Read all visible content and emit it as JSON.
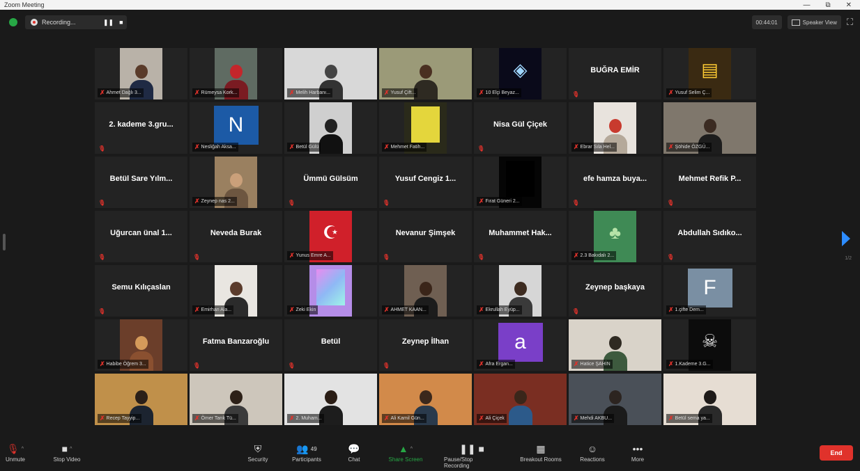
{
  "window": {
    "title": "Zoom Meeting",
    "controls": [
      "—",
      "⧉",
      "✕"
    ]
  },
  "topbar": {
    "recording_label": "Recording...",
    "pause_glyph": "❚❚",
    "stop_glyph": "■",
    "recording_timer": "00:44:01",
    "view_label": "Speaker View",
    "fullscreen_glyph": "⛶"
  },
  "gallery": {
    "page_indicator": "1/2",
    "tiles": [
      {
        "kind": "video",
        "label": "Ahmet Dağlı 3...",
        "bg": "#b9b2a8",
        "head": "#5a3b2a",
        "body": "#1f2a44"
      },
      {
        "kind": "video",
        "label": "Rümeysa Kork...",
        "bg": "#5f6b62",
        "head": "#c4262b",
        "body": "#7a1b22"
      },
      {
        "kind": "video",
        "label": "Melih Harbanı...",
        "bg": "#d8d8d8",
        "head": "#444",
        "body": "#333",
        "wide": true
      },
      {
        "kind": "video",
        "label": "Yusuf Çift...",
        "bg": "#9b9a78",
        "head": "#4a3021",
        "body": "#2e2a22",
        "wide": true,
        "active": true
      },
      {
        "kind": "image",
        "label": "10 Elçi Beyaz...",
        "bg": "#0a0a1a",
        "glyph": "◈",
        "color": "#9fd6ff"
      },
      {
        "kind": "name",
        "name": "BUĞRA EMİR"
      },
      {
        "kind": "image",
        "label": "Yusuf Selim Ç...",
        "bg": "#3a2a12",
        "glyph": "▤",
        "color": "#ffcc33"
      },
      {
        "kind": "name",
        "name": "2. kademe 3.gru..."
      },
      {
        "kind": "avatar",
        "label": "Nesliğah Aksa...",
        "bg": "#1c5aa6",
        "letter": "N"
      },
      {
        "kind": "video",
        "label": "Betül Gülü",
        "bg": "#cfcfcf",
        "head": "#222",
        "body": "#111"
      },
      {
        "kind": "image",
        "label": "Mehmet Fatih...",
        "bg": "#2a2a1a",
        "glyph": "",
        "color": "#e4d63c",
        "block": "#e4d63c"
      },
      {
        "kind": "name",
        "name": "Nisa Gül Çiçek"
      },
      {
        "kind": "video",
        "label": "Ebrar Sıla Hel...",
        "bg": "#e8e3dd",
        "head": "#c83a2e",
        "body": "#b5a99a"
      },
      {
        "kind": "video",
        "label": "Şöhide ÖZGÜ...",
        "bg": "#7f776c",
        "head": "#3b2b22",
        "body": "#1d1d1d",
        "wide": true
      },
      {
        "kind": "name",
        "name": "Betül Sare Yılm..."
      },
      {
        "kind": "video",
        "label": "Zeynep nas 2...",
        "bg": "#9a8060",
        "head": "#caa07a",
        "body": "#6d5640"
      },
      {
        "kind": "name",
        "name": "Ümmü Gülsüm"
      },
      {
        "kind": "name",
        "name": "Yusuf Cengiz 1..."
      },
      {
        "kind": "image",
        "label": "Fırat Güneri 2...",
        "bg": "#050505",
        "glyph": "",
        "color": "#000",
        "block": "#000"
      },
      {
        "kind": "name",
        "name": "efe hamza buya..."
      },
      {
        "kind": "name",
        "name": "Mehmet Refik P..."
      },
      {
        "kind": "name",
        "name": "Uğurcan ünal 1..."
      },
      {
        "kind": "name",
        "name": "Neveda Burak"
      },
      {
        "kind": "image",
        "label": "Yunus Emre A...",
        "bg": "#d0202a",
        "glyph": "☪",
        "color": "#ffffff"
      },
      {
        "kind": "name",
        "name": "Nevanur Şimşek"
      },
      {
        "kind": "name",
        "name": "Muhammet Hak..."
      },
      {
        "kind": "image",
        "label": "2.3 Bakıdalı 2...",
        "bg": "#3f8a55",
        "glyph": "♣",
        "color": "#b6e3a8"
      },
      {
        "kind": "name",
        "name": "Abdullah Sıdıko..."
      },
      {
        "kind": "name",
        "name": "Semu Kılıçaslan"
      },
      {
        "kind": "video",
        "label": "Emirhan Ala...",
        "bg": "#e9e6e1",
        "head": "#5b3c2c",
        "body": "#2b2b2b"
      },
      {
        "kind": "image",
        "label": "Zeki Ekin",
        "bg": "#b58de8",
        "glyph": "",
        "color": "#fff",
        "block": "linear-gradient(135deg,#e88cf0,#8fb8f5,#9ff5e8)"
      },
      {
        "kind": "video",
        "label": "AHMET KAAN...",
        "bg": "#6f5f52",
        "head": "#3a2519",
        "body": "#1c1c1c"
      },
      {
        "kind": "video",
        "label": "Ekrullah Eyüp...",
        "bg": "#d6d6d6",
        "head": "#3d2b20",
        "body": "#3a3a3a"
      },
      {
        "kind": "name",
        "name": "Zeynep başkaya"
      },
      {
        "kind": "avatar",
        "label": "1.çifte Dem...",
        "bg": "#7a8fa3",
        "letter": "F"
      },
      {
        "kind": "video",
        "label": "Habibe Öğrem 3...",
        "bg": "#6b3e2a",
        "head": "#d49a5a",
        "body": "#8a5030"
      },
      {
        "kind": "name",
        "name": "Fatma Banzaroğlu"
      },
      {
        "kind": "name",
        "name": "Betül"
      },
      {
        "kind": "name",
        "name": "Zeynep İlhan"
      },
      {
        "kind": "avatar",
        "label": "Afra Ergan...",
        "bg": "#7a3fc8",
        "letter": "a"
      },
      {
        "kind": "video",
        "label": "Hatice ŞAHİN",
        "bg": "#d9d3c9",
        "head": "#2f2a22",
        "body": "#3d5a3e",
        "wide": true
      },
      {
        "kind": "image",
        "label": "1.Kademe 3.G...",
        "bg": "#0c0c0c",
        "glyph": "☠",
        "color": "#e8e8e8"
      },
      {
        "kind": "video",
        "label": "Recep Tayyip...",
        "bg": "#c0904a",
        "head": "#2a1f18",
        "body": "#1c2430",
        "wide": true
      },
      {
        "kind": "video",
        "label": "Ömer Tarık Tü...",
        "bg": "#cdc6bb",
        "head": "#2d2118",
        "body": "#3b3b3b",
        "wide": true
      },
      {
        "kind": "video",
        "label": "2. Muham...",
        "bg": "#e3e3e3",
        "head": "#2a1d15",
        "body": "#1d1d1d",
        "wide": true
      },
      {
        "kind": "video",
        "label": "Ali Kamil Gün...",
        "bg": "#d28a4a",
        "head": "#3b281c",
        "body": "#2a3a4c",
        "wide": true
      },
      {
        "kind": "video",
        "label": "Ali Çiçek",
        "bg": "#7a2e22",
        "head": "#3a261a",
        "body": "#2c5a8a",
        "wide": true
      },
      {
        "kind": "video",
        "label": "Mehdi AKBU...",
        "bg": "#4a5058",
        "head": "#2c2420",
        "body": "#1b1b1b",
        "wide": true
      },
      {
        "kind": "video",
        "label": "Betül sema ya...",
        "bg": "#e6ddd3",
        "head": "#1e1a18",
        "body": "#2a2a2a",
        "wide": true
      }
    ]
  },
  "toolbar": {
    "items": [
      {
        "label": "Unmute",
        "glyph": "🎙"
      },
      {
        "label": "Stop Video",
        "glyph": "■"
      },
      {
        "label": "Security",
        "glyph": "⛨"
      },
      {
        "label": "Participants",
        "glyph": "👥",
        "count": "49"
      },
      {
        "label": "Chat",
        "glyph": "💬"
      },
      {
        "label": "Share Screen",
        "glyph": "▲"
      },
      {
        "label": "Pause/Stop Recording",
        "glyph": "❚❚ ■"
      },
      {
        "label": "Breakout Rooms",
        "glyph": "▦"
      },
      {
        "label": "Reactions",
        "glyph": "☺"
      },
      {
        "label": "More",
        "glyph": "•••"
      }
    ],
    "end_label": "End"
  },
  "colors": {
    "background": "#1a1a1a",
    "tile": "#232323",
    "active_speaker": "#c3d848",
    "muted": "#e0322b",
    "share_green": "#27a745",
    "end_red": "#e0322b",
    "accent_blue": "#2d8cff"
  }
}
